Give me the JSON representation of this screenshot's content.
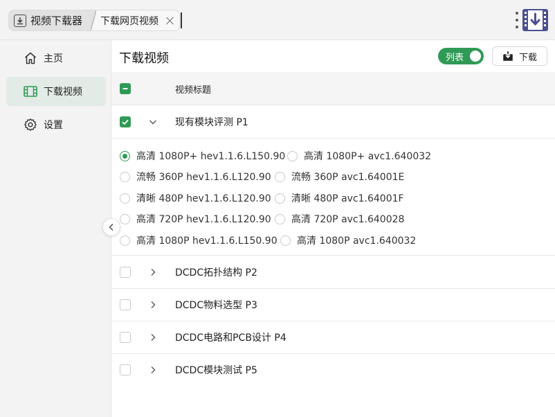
{
  "app": {
    "title": "视频下载器",
    "active_tab": "下载网页视频"
  },
  "colors": {
    "accent": "#2f9a56",
    "sidebar_bg": "#f3f3f3",
    "active_nav_bg": "#e3ebe6"
  },
  "sidebar": {
    "items": [
      {
        "label": "主页",
        "icon": "home-icon"
      },
      {
        "label": "下载视频",
        "icon": "film-icon",
        "active": true
      },
      {
        "label": "设置",
        "icon": "gear-icon"
      }
    ]
  },
  "main": {
    "title": "下载视频",
    "toggle_label": "列表",
    "download_label": "下载",
    "table_header": "视频标题",
    "rows": [
      {
        "title": "现有模块评测 P1",
        "checked": true,
        "expanded": true
      },
      {
        "title": "DCDC拓扑结构 P2",
        "checked": false,
        "expanded": false
      },
      {
        "title": "DCDC物料选型 P3",
        "checked": false,
        "expanded": false
      },
      {
        "title": "DCDC电路和PCB设计 P4",
        "checked": false,
        "expanded": false
      },
      {
        "title": "DCDC模块测试 P5",
        "checked": false,
        "expanded": false
      }
    ],
    "quality_options": [
      {
        "label": "高清 1080P+ hev1.1.6.L150.90",
        "selected": true
      },
      {
        "label": "高清 1080P+ avc1.640032",
        "selected": false
      },
      {
        "label": "流畅 360P hev1.1.6.L120.90",
        "selected": false
      },
      {
        "label": "流畅 360P avc1.64001E",
        "selected": false
      },
      {
        "label": "清晰 480P hev1.1.6.L120.90",
        "selected": false
      },
      {
        "label": "清晰 480P avc1.64001F",
        "selected": false
      },
      {
        "label": "高清 720P hev1.1.6.L120.90",
        "selected": false
      },
      {
        "label": "高清 720P avc1.640028",
        "selected": false
      },
      {
        "label": "高清 1080P hev1.1.6.L150.90",
        "selected": false
      },
      {
        "label": "高清 1080P avc1.640032",
        "selected": false
      }
    ]
  }
}
